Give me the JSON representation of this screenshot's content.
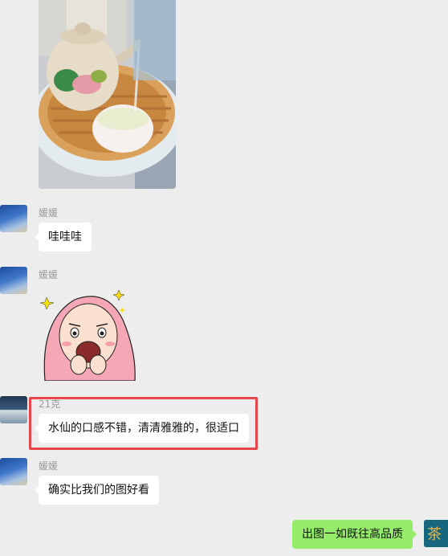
{
  "messages": [
    {
      "sender": "媛媛",
      "text": "哇哇哇"
    },
    {
      "sender": "媛媛",
      "type": "sticker"
    },
    {
      "sender": "21克",
      "text": "水仙的口感不错，清清雅雅的，很适口"
    },
    {
      "sender": "媛媛",
      "text": "确实比我们的图好看"
    },
    {
      "sender": "me",
      "text": "出图一如既往高品质"
    }
  ],
  "my_avatar": {
    "text": "茶"
  },
  "colors": {
    "background": "#ededed",
    "incoming_bubble": "#ffffff",
    "outgoing_bubble": "#95ec69",
    "highlight_border": "#e8464b"
  }
}
